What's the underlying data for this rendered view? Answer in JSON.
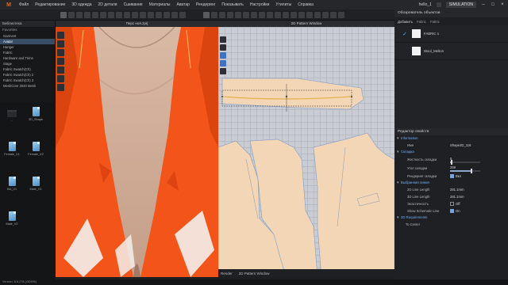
{
  "menubar": {
    "logo": "M",
    "items": [
      "Файл",
      "Редактирование",
      "3D одежда",
      "2D детали",
      "Сшивание",
      "Материалы",
      "Аватар",
      "Рендеринг",
      "Показывать",
      "Настройки",
      "Утилиты",
      "Справка"
    ],
    "user": "hello_1",
    "mode": "SIMULATION"
  },
  "library": {
    "title": "Библиотека",
    "favorites_label": "Favorites",
    "tree": [
      "Garment",
      "Avatar",
      "Hanger",
      "Fabric",
      "Hardware and Trims",
      "Stage",
      "Fabric Swatch(Ch)",
      "Fabric Swatch(Ch) 2",
      "Fabric Swatch(Ch) 3",
      "MeshCore 2020 Mesh"
    ],
    "selected_index": 1,
    "files": [
      {
        "label": ".."
      },
      {
        "label": "3D_Shape"
      },
      {
        "label": "Female_V1"
      },
      {
        "label": "Female_V2"
      },
      {
        "label": "Kid_V1"
      },
      {
        "label": "Male_V1"
      },
      {
        "label": "Male_V2"
      }
    ]
  },
  "view3d": {
    "title": "Перс ноя.zprj"
  },
  "view2d": {
    "title": "2D Pattern Window"
  },
  "bottom_tabs": [
    "Render",
    "2D Pattern Window"
  ],
  "status": "Version: 8.6.278 (r30996)",
  "object_browser": {
    "title": "Обозреватель объектов",
    "tabs": [
      "Добавить",
      "Fabric",
      "Fabric"
    ],
    "fabrics": [
      {
        "name": "FABRIC 1",
        "checked": true
      },
      {
        "name": "Wool_Melton",
        "checked": false
      }
    ]
  },
  "property_editor": {
    "title": "Редактор свойств",
    "sections": {
      "information": "Information",
      "fold": "Складка",
      "line": "Выбранная линия",
      "req": "2D Requirements"
    },
    "rows": {
      "name_key": "Имя",
      "name_val": "Shape2D_116",
      "stiff_key": "Жесткость складки",
      "stiff_val": "5",
      "angle_key": "Угол складки",
      "angle_val": "259",
      "render_key": "Рендеринг складки",
      "render_val": "Вкл",
      "len2d_key": "2D Line Length",
      "len2d_val": "281.1mm",
      "len3d_key": "3D Line Length",
      "len3d_val": "281.1mm",
      "elastic_key": "Эластичность",
      "elastic_val": "Off",
      "schem_key": "Show Schematic Line",
      "schem_val": "On",
      "center_label": "To Center"
    },
    "stiff_fraction": 0.05,
    "angle_fraction": 0.72
  }
}
